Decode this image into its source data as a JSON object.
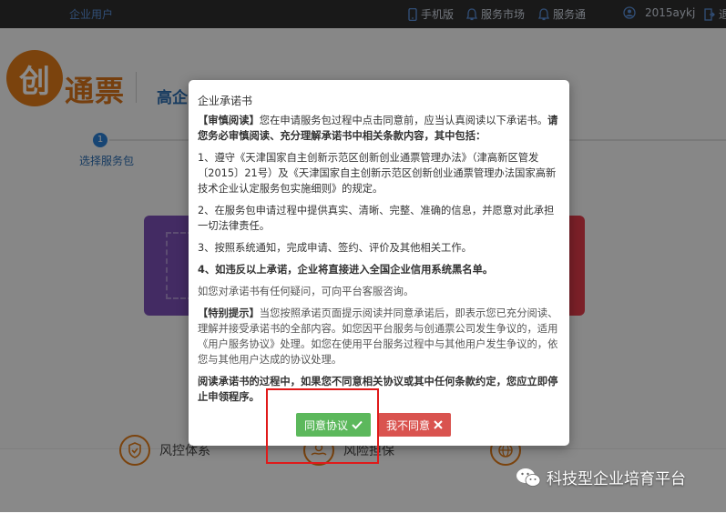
{
  "topbar": {
    "brand_link": "企业用户",
    "mobile": "手机版",
    "service_market": "服务市场",
    "service_link": "服务通",
    "username": "2015aykj",
    "logout_partial": "退"
  },
  "page": {
    "logo_char": "创",
    "logo_text": "通票",
    "title": "高企",
    "step_number": "1",
    "step_label": "选择服务包"
  },
  "features": [
    {
      "label": "风控体系",
      "icon": "shield-icon"
    },
    {
      "label": "风险担保",
      "icon": "hand-coin-icon"
    },
    {
      "label": "",
      "icon": "globe-icon"
    }
  ],
  "watermark": {
    "text": "科技型企业培育平台"
  },
  "modal": {
    "title": "企业承诺书",
    "p1_lead": "【审慎阅读】",
    "p1_normal": "您在申请服务包过程中点击同意前，应当认真阅读以下承诺书。",
    "p1_bold": "请您务必审慎阅读、充分理解承诺书中相关条款内容，其中包括：",
    "p2": "1、遵守《天津国家自主创新示范区创新创业通票管理办法》（津高新区管发〔2015〕21号）及《天津国家自主创新示范区创新创业通票管理办法国家高新技术企业认定服务包实施细则》的规定。",
    "p3": "2、在服务包申请过程中提供真实、清晰、完整、准确的信息，并愿意对此承担一切法律责任。",
    "p4": "3、按照系统通知，完成申请、签约、评价及其他相关工作。",
    "p5": "4、如违反以上承诺，企业将直接进入全国企业信用系统黑名单。",
    "p6": "如您对承诺书有任何疑问，可向平台客服咨询。",
    "p7_lead": "【特别提示】",
    "p7_normal": "当您按照承诺页面提示阅读并同意承诺后，即表示您已充分阅读、理解并接受承诺书的全部内容。如您因平台服务与创通票公司发生争议的，适用《用户服务协议》处理。如您在使用平台服务过程中与其他用户发生争议的，依您与其他用户达成的协议处理。",
    "p8": "阅读承诺书的过程中，如果您不同意相关协议或其中任何条款约定，您应立即停止申领程序。",
    "agree_label": "同意协议",
    "reject_label": "我不同意"
  }
}
